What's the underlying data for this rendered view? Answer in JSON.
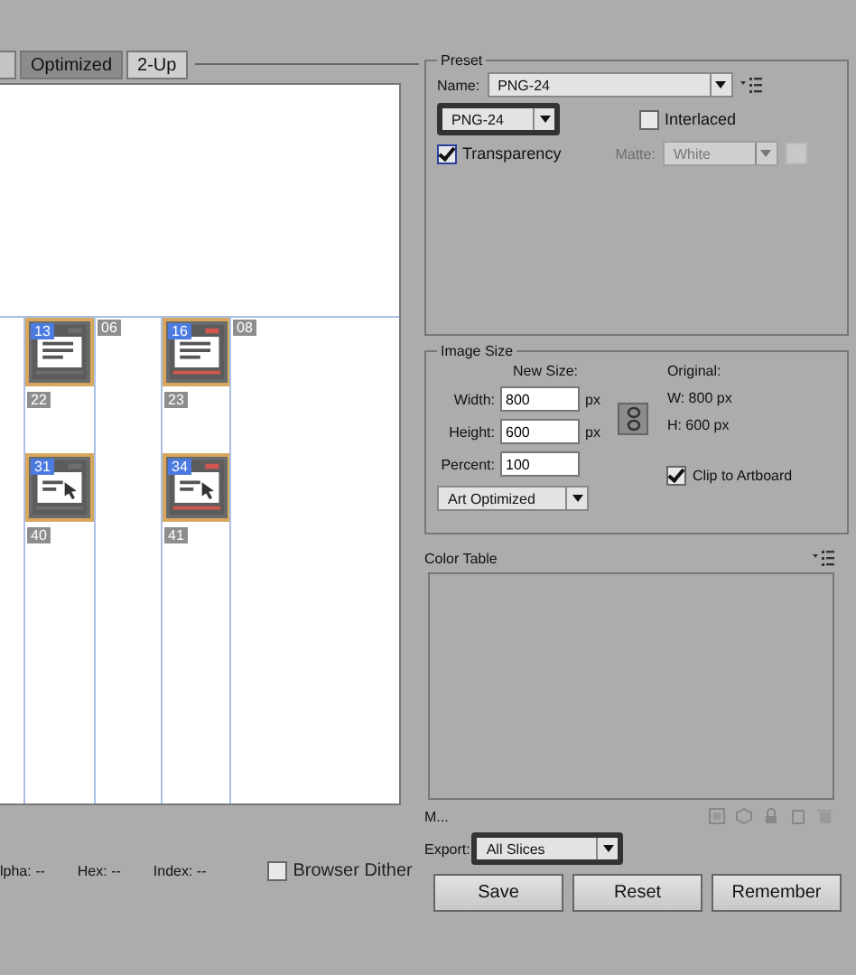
{
  "preview": {
    "tabs": [
      {
        "label": "Optimized",
        "selected": true
      },
      {
        "label": "2-Up",
        "selected": false
      }
    ],
    "slice_rows": [
      [
        {
          "number": "13",
          "kind": "text-tile",
          "color": "#6e6e6e"
        },
        {
          "number": "06",
          "kind": "label"
        },
        {
          "number": "16",
          "kind": "text-tile",
          "color": "#d0574e"
        },
        {
          "number": "08",
          "kind": "label"
        }
      ],
      [
        {
          "number": "22",
          "kind": "label"
        },
        {
          "kind": "empty"
        },
        {
          "number": "23",
          "kind": "label"
        },
        {
          "kind": "empty"
        }
      ],
      [
        {
          "number": "31",
          "kind": "pointer-tile",
          "color": "#6e6e6e"
        },
        {
          "kind": "empty"
        },
        {
          "number": "34",
          "kind": "pointer-tile",
          "color": "#d0574e"
        },
        {
          "kind": "empty"
        }
      ],
      [
        {
          "number": "40",
          "kind": "label"
        },
        {
          "kind": "empty"
        },
        {
          "number": "41",
          "kind": "label"
        },
        {
          "kind": "empty"
        }
      ]
    ]
  },
  "color_info": [
    {
      "label": "lpha:",
      "value": "--"
    },
    {
      "label": "Hex:",
      "value": "--"
    },
    {
      "label": "Index:",
      "value": "--"
    }
  ],
  "browser_dither": {
    "label": "Browser Dither",
    "checked": false
  },
  "preset": {
    "title": "Preset",
    "name_label": "Name:",
    "name_value": "PNG-24",
    "format": "PNG-24",
    "interlaced": {
      "label": "Interlaced",
      "checked": false
    },
    "transparency": {
      "label": "Transparency",
      "checked": true
    },
    "matte": {
      "label": "Matte:",
      "value": "White",
      "disabled": true
    }
  },
  "image_size": {
    "title": "Image Size",
    "new_size": "New Size:",
    "fields": [
      {
        "label": "Width:",
        "value": "800",
        "unit": "px"
      },
      {
        "label": "Height:",
        "value": "600",
        "unit": "px"
      },
      {
        "label": "Percent:",
        "value": "100"
      }
    ],
    "original": "Original:",
    "original_w": "W:  800 px",
    "original_h": "H:  600 px",
    "quality": "Art Optimized",
    "clip": {
      "label": "Clip to Artboard",
      "checked": true
    }
  },
  "color_table": {
    "title": "Color Table",
    "status": "M..."
  },
  "export": {
    "label": "Export:",
    "value": "All Slices"
  },
  "buttons": [
    "Save",
    "Reset",
    "Remember"
  ]
}
